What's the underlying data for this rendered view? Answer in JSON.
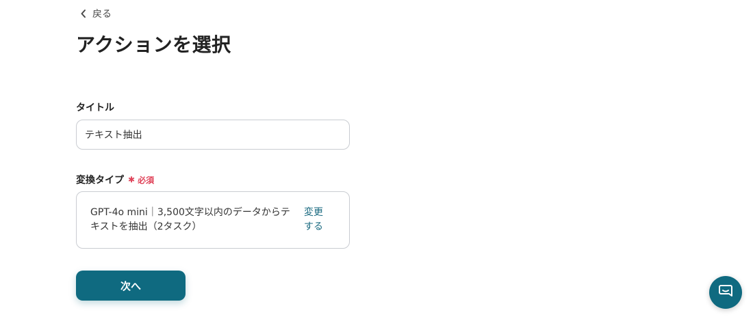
{
  "nav": {
    "back_label": "戻る",
    "back_icon": "chevron-left-icon"
  },
  "page": {
    "title": "アクションを選択"
  },
  "form": {
    "title_field": {
      "label": "タイトル",
      "value": "テキスト抽出"
    },
    "type_field": {
      "label": "変換タイプ",
      "required_mark": "✱",
      "required_text": "必須",
      "selected_line1": "GPT-4o mini｜3,500文字以内のデータからテ",
      "selected_line2": "キストを抽出（2タスク）",
      "change_line1": "変更",
      "change_line2": "する"
    },
    "next_button_label": "次へ"
  },
  "chat": {
    "icon": "chat-bubble-icon"
  },
  "colors": {
    "primary": "#0f6a80",
    "link": "#1a6a80",
    "required": "#e0445a",
    "border": "#c9ccd1"
  }
}
